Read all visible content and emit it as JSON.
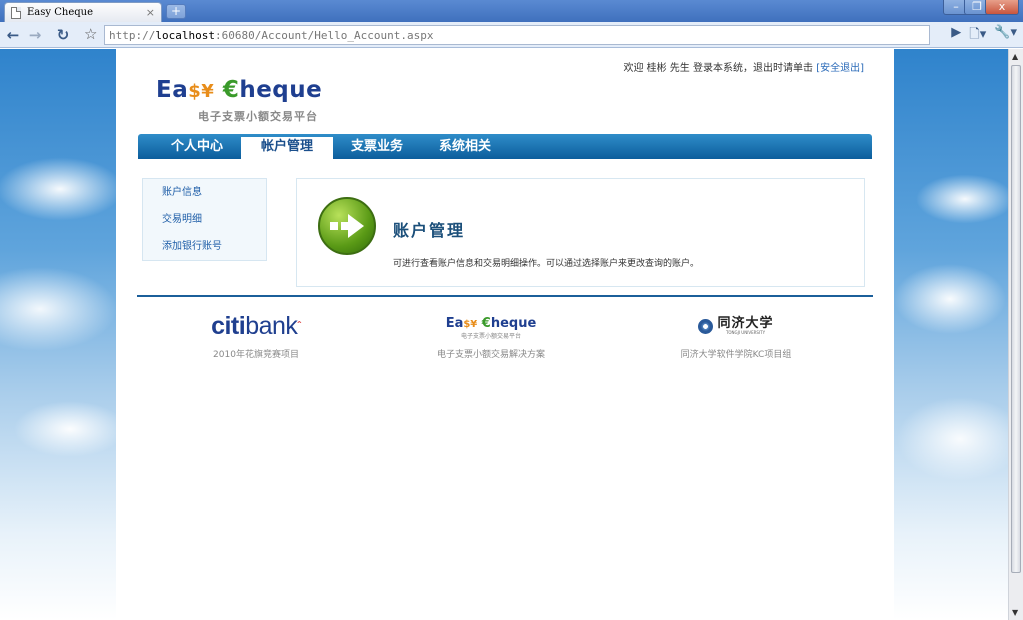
{
  "browser": {
    "tab_title": "Easy Cheque",
    "tab_close": "×",
    "new_tab": "+",
    "url_prefix": "http://",
    "url_host": "localhost",
    "url_rest": ":60680/Account/Hello_Account.aspx",
    "window_controls": [
      "–",
      "❐",
      "x"
    ]
  },
  "header": {
    "welcome_text": "欢迎 桂彬 先生 登录本系统，退出时请单击",
    "logout_link": "[安全退出]",
    "logo_ea": "Ea",
    "logo_symbols": "$¥",
    "logo_euro": "€",
    "logo_heque": "heque",
    "logo_subtitle": "电子支票小额交易平台"
  },
  "nav": {
    "items": [
      {
        "label": "个人中心",
        "active": false
      },
      {
        "label": "帐户管理",
        "active": true
      },
      {
        "label": "支票业务",
        "active": false
      },
      {
        "label": "系统相关",
        "active": false
      }
    ]
  },
  "sidebar": {
    "links": [
      {
        "label": "账户信息"
      },
      {
        "label": "交易明细"
      },
      {
        "label": "添加银行账号"
      }
    ]
  },
  "main": {
    "title": "账户管理",
    "description": "可进行查看账户信息和交易明细操作。可以通过选择账户来更改查询的账户。",
    "icon": "right-arrow-icon"
  },
  "footer": {
    "partners": [
      {
        "logo": "citibank",
        "caption": "2010年花旗竞赛项目"
      },
      {
        "logo": "Easy Cheque",
        "sub": "电子支票小额交易平台",
        "caption": "电子支票小额交易解决方案"
      },
      {
        "logo": "同济大学",
        "sub": "TONGJI UNIVERSITY",
        "caption": "同济大学软件学院KC项目组"
      }
    ]
  },
  "colors": {
    "nav_blue": "#0c5d9c",
    "link_blue": "#1f5ea8",
    "brand_navy": "#1f3f90",
    "brand_green": "#3a9a2a",
    "brand_orange": "#e88d1a"
  }
}
